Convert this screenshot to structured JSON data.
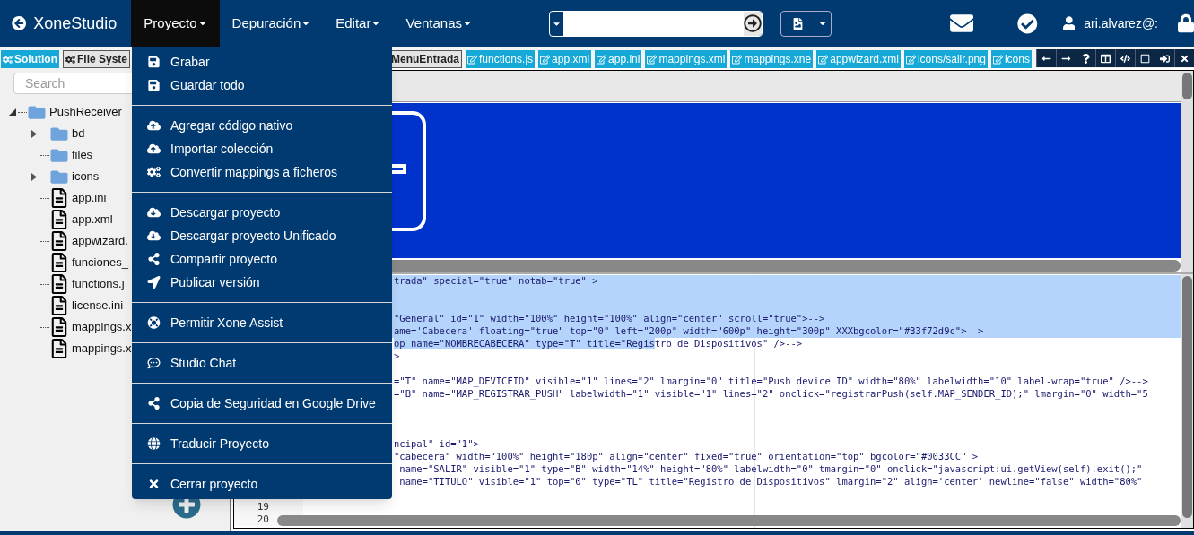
{
  "app": {
    "title": "XoneStudio"
  },
  "nav_menu": [
    {
      "label": "Proyecto",
      "selected": true
    },
    {
      "label": "Depuración",
      "selected": false
    },
    {
      "label": "Editar",
      "selected": false
    },
    {
      "label": "Ventanas",
      "selected": false
    }
  ],
  "user": {
    "name": "ari.alvarez@:"
  },
  "sidebar": {
    "tabs": [
      {
        "label": "Solution",
        "selected": false
      },
      {
        "label": "File Syste",
        "selected": true
      }
    ],
    "search": {
      "placeholder": "Search"
    },
    "tree": [
      {
        "label": "PushReceiver",
        "kind": "folder",
        "expanded": true,
        "children": [
          {
            "label": "bd",
            "kind": "folder",
            "expanded": false
          },
          {
            "label": "files",
            "kind": "folder"
          },
          {
            "label": "icons",
            "kind": "folder",
            "expanded": false
          },
          {
            "label": "app.ini",
            "kind": "file"
          },
          {
            "label": "app.xml",
            "kind": "file"
          },
          {
            "label": "appwizard.",
            "kind": "file"
          },
          {
            "label": "funciones_",
            "kind": "file"
          },
          {
            "label": "functions.j",
            "kind": "file"
          },
          {
            "label": "license.ini",
            "kind": "file"
          },
          {
            "label": "mappings.x",
            "kind": "file"
          },
          {
            "label": "mappings.x",
            "kind": "file"
          }
        ]
      }
    ]
  },
  "editor": {
    "tabs": [
      {
        "label": "MenuEntrada",
        "selected": true
      },
      {
        "label": "functions.js",
        "selected": false
      },
      {
        "label": "app.xml",
        "selected": false
      },
      {
        "label": "app.ini",
        "selected": false
      },
      {
        "label": "mappings.xml",
        "selected": false
      },
      {
        "label": "mappings.xne",
        "selected": false
      },
      {
        "label": "appwizard.xml",
        "selected": false
      },
      {
        "label": "icons/salir.png",
        "selected": false
      },
      {
        "label": "icons",
        "selected": false
      }
    ],
    "code_lines": [
      {
        "text": "trada\" special=\"true\" notab=\"true\" >",
        "selected": true
      },
      {
        "selected": true
      },
      {
        "selected": true
      },
      {
        "text": "\"General\" id=\"1\" width=\"100%\" height=\"100%\" align=\"center\" scroll=\"true\">-->",
        "selected": true
      },
      {
        "text": "ame='Cabecera' floating=\"true\" top=\"0\" left=\"200p\" width=\"600p\" height=\"300p\" XXXbgcolor=\"#33f72d9c\">-->",
        "selected": true
      },
      {
        "selected_text": "op name=\"NOMBRECABECERA\" type=\"T\" title=\"Regis",
        "text": "tro de Dispositivos\" />-->",
        "selected": true
      },
      {
        "text": ">",
        "selected": false
      },
      {
        "selected": false
      },
      {
        "text": "=\"T\" name=\"MAP_DEVICEID\" visible=\"1\" lines=\"2\" lmargin=\"0\" title=\"Push device ID\" width=\"80%\" labelwidth=\"10\" label-wrap=\"true\" />-->",
        "selected": false
      },
      {
        "text": "=\"B\" name=\"MAP_REGISTRAR_PUSH\" labelwidth=\"1\" visible=\"1\" lines=\"2\" onclick=\"registrarPush(self.MAP_SENDER_ID);\" lmargin=\"0\" width=\"5",
        "selected": false
      },
      {
        "selected": false
      },
      {
        "selected": false
      },
      {
        "selected": false
      },
      {
        "text": "ncipal\" id=\"1\">",
        "selected": false
      },
      {
        "text": "\"cabecera\" width=\"100%\" height=\"180p\" align=\"center\" fixed=\"true\" orientation=\"top\" bgcolor=\"#0033CC\" >",
        "selected": false
      },
      {
        "text": " name=\"SALIR\" visible=\"1\" type=\"B\" width=\"14%\" height=\"80%\" labelwidth=\"0\" tmargin=\"0\" onclick=\"javascript:ui.getView(self).exit();\"",
        "selected": false
      },
      {
        "text": " name=\"TITULO\" visible=\"1\" top=\"0\" type=\"TL\" title=\"Registro de Dispositivos\" lmargin=\"2\" align='center' newline=\"false\" width=\"80%\"",
        "selected": false
      },
      {
        "selected": false
      },
      {
        "number": "19",
        "selected": false
      },
      {
        "number": "20",
        "selected": false
      }
    ]
  },
  "project_menu": {
    "groups": [
      {
        "items": [
          "Grabar",
          "Guardar todo"
        ]
      },
      {
        "items": [
          "Agregar código nativo",
          "Importar colección",
          "Convertir mappings a ficheros"
        ]
      },
      {
        "items": [
          "Descargar proyecto",
          "Descargar proyecto Unificado",
          "Compartir proyecto",
          "Publicar versión"
        ]
      },
      {
        "items": [
          "Permitir Xone Assist"
        ]
      },
      {
        "items": [
          "Studio Chat"
        ]
      },
      {
        "items": [
          "Copia de Seguridad en Google Drive"
        ]
      },
      {
        "items": [
          "Traducir Proyecto"
        ]
      },
      {
        "items": [
          "Cerrar proyecto"
        ]
      }
    ]
  }
}
